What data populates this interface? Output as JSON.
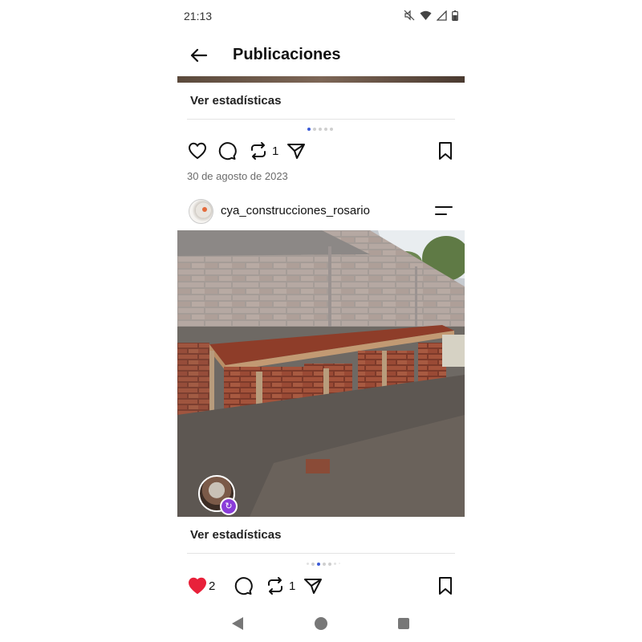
{
  "status_bar": {
    "time": "21:13",
    "icons": [
      "mute-icon",
      "wifi-icon",
      "signal-icon",
      "battery-icon"
    ]
  },
  "header": {
    "title": "Publicaciones",
    "back_icon": "arrow-left-icon"
  },
  "posts": [
    {
      "stats_link": "Ver estadísticas",
      "carousel": {
        "count": 5,
        "active_index": 0
      },
      "repost_count": "1",
      "liked": false,
      "date": "30 de agosto de 2023"
    },
    {
      "username": "cya_construcciones_rosario",
      "stats_link": "Ver estadísticas",
      "carousel": {
        "count": 7,
        "active_index": 2
      },
      "like_count": "2",
      "repost_count": "1",
      "liked": true
    }
  ],
  "colors": {
    "accent": "#3c5bd7",
    "like": "#e8213a",
    "badge": "#8a3cd9"
  },
  "nav": {
    "items": [
      "back-triangle-icon",
      "home-circle-icon",
      "recents-square-icon"
    ]
  }
}
